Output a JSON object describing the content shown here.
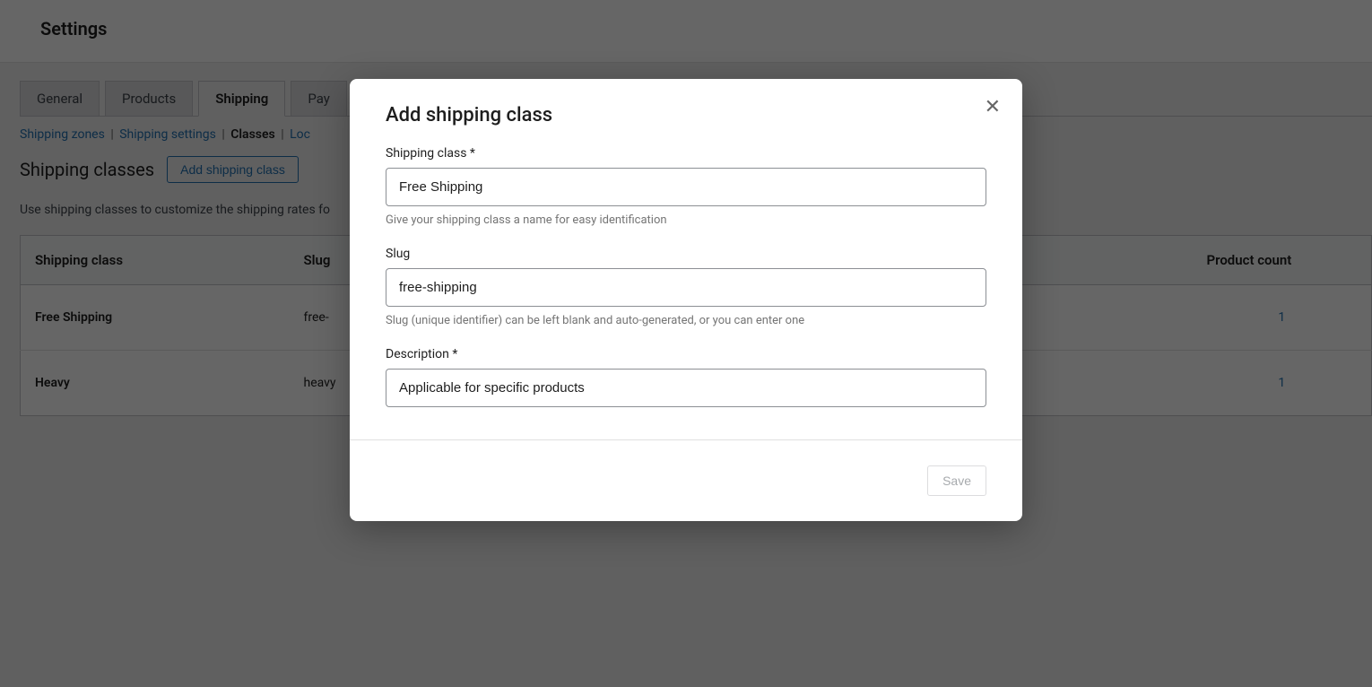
{
  "header": {
    "title": "Settings"
  },
  "tabs": {
    "general": "General",
    "products": "Products",
    "shipping": "Shipping",
    "payments": "Pay"
  },
  "subnav": {
    "zones": "Shipping zones",
    "settings": "Shipping settings",
    "classes": "Classes",
    "local": "Loc"
  },
  "section": {
    "title": "Shipping classes",
    "add_button": "Add shipping class",
    "description": "Use shipping classes to customize the shipping rates fo"
  },
  "table": {
    "headers": {
      "name": "Shipping class",
      "slug": "Slug",
      "count": "Product count"
    },
    "rows": [
      {
        "name": "Free Shipping",
        "slug": "free-",
        "count": "1"
      },
      {
        "name": "Heavy",
        "slug": "heavy",
        "count": "1"
      }
    ]
  },
  "modal": {
    "title": "Add shipping class",
    "fields": {
      "name": {
        "label": "Shipping class *",
        "value": "Free Shipping",
        "hint": "Give your shipping class a name for easy identification"
      },
      "slug": {
        "label": "Slug",
        "value": "free-shipping",
        "hint": "Slug (unique identifier) can be left blank and auto-generated, or you can enter one"
      },
      "description": {
        "label": "Description *",
        "value": "Applicable for specific products"
      }
    },
    "save": "Save"
  }
}
